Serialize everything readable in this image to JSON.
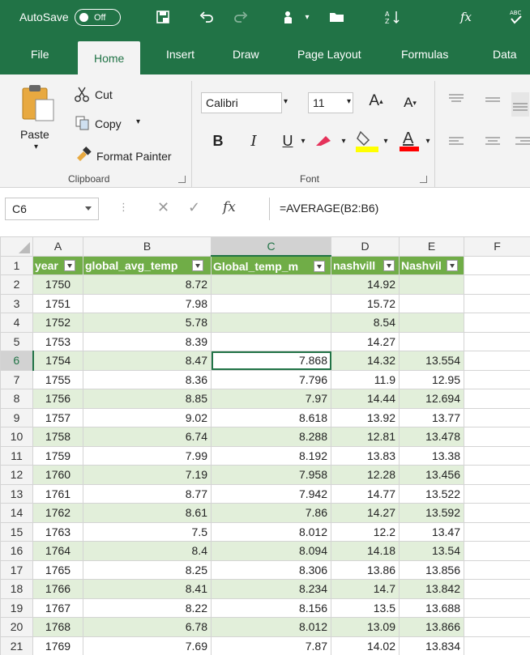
{
  "qat": {
    "autosave_label": "AutoSave",
    "autosave_state": "Off"
  },
  "tabs": [
    {
      "label": "File"
    },
    {
      "label": "Home"
    },
    {
      "label": "Insert"
    },
    {
      "label": "Draw"
    },
    {
      "label": "Page Layout"
    },
    {
      "label": "Formulas"
    },
    {
      "label": "Data"
    }
  ],
  "ribbon": {
    "clipboard": {
      "paste": "Paste",
      "cut": "Cut",
      "copy": "Copy",
      "format_painter": "Format Painter",
      "group_label": "Clipboard"
    },
    "font": {
      "font_name": "Calibri",
      "font_size": "11",
      "group_label": "Font"
    },
    "colors": {
      "accent": "#217346",
      "highlight": "#ffff00",
      "font_color": "#ff0000"
    }
  },
  "formula_bar": {
    "name_box": "C6",
    "formula": "=AVERAGE(B2:B6)",
    "fx_label": "fx"
  },
  "sheet": {
    "columns": [
      "A",
      "B",
      "C",
      "D",
      "E",
      "F"
    ],
    "headers": [
      "year",
      "global_avg_temp",
      "Global_temp_m",
      "nashvill",
      "Nashvil"
    ],
    "rows": [
      {
        "n": "2",
        "a": "1750",
        "b": "8.72",
        "c": "",
        "d": "14.92",
        "e": ""
      },
      {
        "n": "3",
        "a": "1751",
        "b": "7.98",
        "c": "",
        "d": "15.72",
        "e": ""
      },
      {
        "n": "4",
        "a": "1752",
        "b": "5.78",
        "c": "",
        "d": "8.54",
        "e": ""
      },
      {
        "n": "5",
        "a": "1753",
        "b": "8.39",
        "c": "",
        "d": "14.27",
        "e": ""
      },
      {
        "n": "6",
        "a": "1754",
        "b": "8.47",
        "c": "7.868",
        "d": "14.32",
        "e": "13.554"
      },
      {
        "n": "7",
        "a": "1755",
        "b": "8.36",
        "c": "7.796",
        "d": "11.9",
        "e": "12.95"
      },
      {
        "n": "8",
        "a": "1756",
        "b": "8.85",
        "c": "7.97",
        "d": "14.44",
        "e": "12.694"
      },
      {
        "n": "9",
        "a": "1757",
        "b": "9.02",
        "c": "8.618",
        "d": "13.92",
        "e": "13.77"
      },
      {
        "n": "10",
        "a": "1758",
        "b": "6.74",
        "c": "8.288",
        "d": "12.81",
        "e": "13.478"
      },
      {
        "n": "11",
        "a": "1759",
        "b": "7.99",
        "c": "8.192",
        "d": "13.83",
        "e": "13.38"
      },
      {
        "n": "12",
        "a": "1760",
        "b": "7.19",
        "c": "7.958",
        "d": "12.28",
        "e": "13.456"
      },
      {
        "n": "13",
        "a": "1761",
        "b": "8.77",
        "c": "7.942",
        "d": "14.77",
        "e": "13.522"
      },
      {
        "n": "14",
        "a": "1762",
        "b": "8.61",
        "c": "7.86",
        "d": "14.27",
        "e": "13.592"
      },
      {
        "n": "15",
        "a": "1763",
        "b": "7.5",
        "c": "8.012",
        "d": "12.2",
        "e": "13.47"
      },
      {
        "n": "16",
        "a": "1764",
        "b": "8.4",
        "c": "8.094",
        "d": "14.18",
        "e": "13.54"
      },
      {
        "n": "17",
        "a": "1765",
        "b": "8.25",
        "c": "8.306",
        "d": "13.86",
        "e": "13.856"
      },
      {
        "n": "18",
        "a": "1766",
        "b": "8.41",
        "c": "8.234",
        "d": "14.7",
        "e": "13.842"
      },
      {
        "n": "19",
        "a": "1767",
        "b": "8.22",
        "c": "8.156",
        "d": "13.5",
        "e": "13.688"
      },
      {
        "n": "20",
        "a": "1768",
        "b": "6.78",
        "c": "8.012",
        "d": "13.09",
        "e": "13.866"
      },
      {
        "n": "21",
        "a": "1769",
        "b": "7.69",
        "c": "7.87",
        "d": "14.02",
        "e": "13.834"
      }
    ]
  }
}
